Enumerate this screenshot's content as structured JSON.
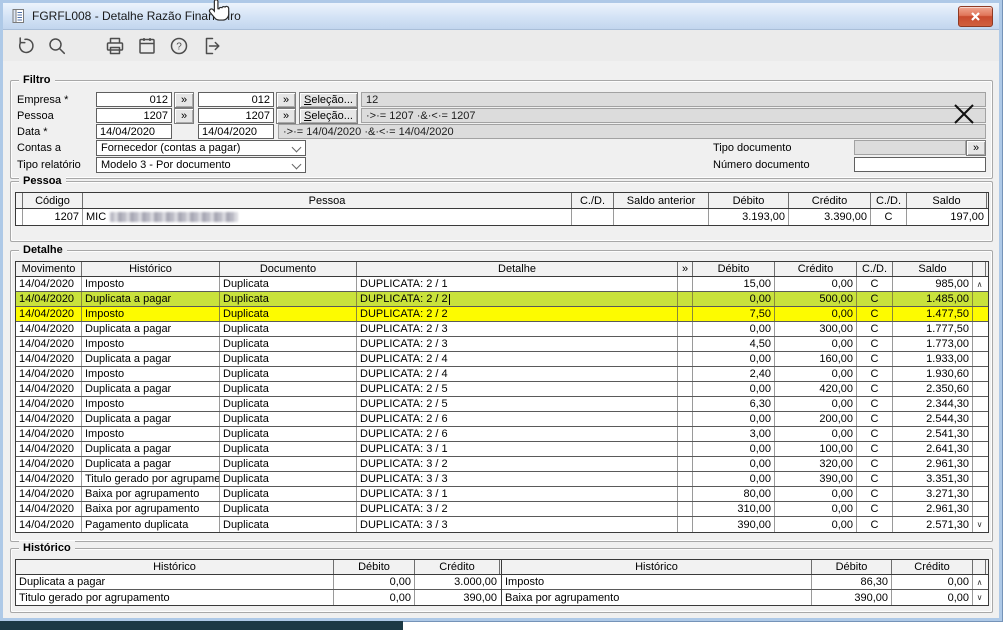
{
  "window": {
    "title": "FGRFL008 - Detalhe Razão Financeiro"
  },
  "toolbar": {
    "icons": [
      "undo",
      "search",
      "print",
      "calendar",
      "help",
      "exit"
    ]
  },
  "filter": {
    "legend": "Filtro",
    "empresa": {
      "label": "Empresa *",
      "from": "012",
      "to": "012",
      "selection": "Seleção...",
      "summary": "12"
    },
    "pessoa": {
      "label": "Pessoa",
      "from": "1207",
      "to": "1207",
      "selection": "Seleção...",
      "summary": "·>·= 1207  ·&·<·= 1207"
    },
    "data": {
      "label": "Data *",
      "from": "14/04/2020",
      "to": "14/04/2020",
      "summary": "·>·= 14/04/2020  ·&·<·= 14/04/2020"
    },
    "contas": {
      "label": "Contas a",
      "value": "Fornecedor (contas a pagar)"
    },
    "tipo_relatorio": {
      "label": "Tipo relatório",
      "value": "Modelo 3 - Por documento"
    },
    "tipo_documento": {
      "label": "Tipo documento",
      "value": ""
    },
    "numero_documento": {
      "label": "Número documento",
      "value": ""
    },
    "more_label": "»"
  },
  "pessoa_section": {
    "legend": "Pessoa",
    "headers": [
      "",
      "Código",
      "Pessoa",
      "C./D.",
      "Saldo anterior",
      "Débito",
      "Crédito",
      "C./D.",
      "Saldo"
    ],
    "row": {
      "codigo": "1207",
      "pessoa_visible": "MIC",
      "cd1": "",
      "saldo_anterior": "",
      "debito": "3.193,00",
      "credito": "3.390,00",
      "cd2": "C",
      "saldo": "197,00"
    }
  },
  "detalhe_section": {
    "legend": "Detalhe",
    "headers": [
      "Movimento",
      "Histórico",
      "Documento",
      "Detalhe",
      "»",
      "Débito",
      "Crédito",
      "C./D.",
      "Saldo",
      ""
    ],
    "rows": [
      {
        "movimento": "14/04/2020",
        "historico": "Imposto",
        "documento": "Duplicata",
        "detalhe": "DUPLICATA: 2 / 1",
        "debito": "15,00",
        "credito": "0,00",
        "cd": "C",
        "saldo": "985,00",
        "highlight": "none"
      },
      {
        "movimento": "14/04/2020",
        "historico": "Duplicata a pagar",
        "documento": "Duplicata",
        "detalhe": "DUPLICATA: 2 / 2",
        "debito": "0,00",
        "credito": "500,00",
        "cd": "C",
        "saldo": "1.485,00",
        "highlight": "green"
      },
      {
        "movimento": "14/04/2020",
        "historico": "Imposto",
        "documento": "Duplicata",
        "detalhe": "DUPLICATA: 2 / 2",
        "debito": "7,50",
        "credito": "0,00",
        "cd": "C",
        "saldo": "1.477,50",
        "highlight": "yellow"
      },
      {
        "movimento": "14/04/2020",
        "historico": "Duplicata a pagar",
        "documento": "Duplicata",
        "detalhe": "DUPLICATA: 2 / 3",
        "debito": "0,00",
        "credito": "300,00",
        "cd": "C",
        "saldo": "1.777,50",
        "highlight": "none"
      },
      {
        "movimento": "14/04/2020",
        "historico": "Imposto",
        "documento": "Duplicata",
        "detalhe": "DUPLICATA: 2 / 3",
        "debito": "4,50",
        "credito": "0,00",
        "cd": "C",
        "saldo": "1.773,00",
        "highlight": "none"
      },
      {
        "movimento": "14/04/2020",
        "historico": "Duplicata a pagar",
        "documento": "Duplicata",
        "detalhe": "DUPLICATA: 2 / 4",
        "debito": "0,00",
        "credito": "160,00",
        "cd": "C",
        "saldo": "1.933,00",
        "highlight": "none"
      },
      {
        "movimento": "14/04/2020",
        "historico": "Imposto",
        "documento": "Duplicata",
        "detalhe": "DUPLICATA: 2 / 4",
        "debito": "2,40",
        "credito": "0,00",
        "cd": "C",
        "saldo": "1.930,60",
        "highlight": "none"
      },
      {
        "movimento": "14/04/2020",
        "historico": "Duplicata a pagar",
        "documento": "Duplicata",
        "detalhe": "DUPLICATA: 2 / 5",
        "debito": "0,00",
        "credito": "420,00",
        "cd": "C",
        "saldo": "2.350,60",
        "highlight": "none"
      },
      {
        "movimento": "14/04/2020",
        "historico": "Imposto",
        "documento": "Duplicata",
        "detalhe": "DUPLICATA: 2 / 5",
        "debito": "6,30",
        "credito": "0,00",
        "cd": "C",
        "saldo": "2.344,30",
        "highlight": "none"
      },
      {
        "movimento": "14/04/2020",
        "historico": "Duplicata a pagar",
        "documento": "Duplicata",
        "detalhe": "DUPLICATA: 2 / 6",
        "debito": "0,00",
        "credito": "200,00",
        "cd": "C",
        "saldo": "2.544,30",
        "highlight": "none"
      },
      {
        "movimento": "14/04/2020",
        "historico": "Imposto",
        "documento": "Duplicata",
        "detalhe": "DUPLICATA: 2 / 6",
        "debito": "3,00",
        "credito": "0,00",
        "cd": "C",
        "saldo": "2.541,30",
        "highlight": "none"
      },
      {
        "movimento": "14/04/2020",
        "historico": "Duplicata a pagar",
        "documento": "Duplicata",
        "detalhe": "DUPLICATA: 3 / 1",
        "debito": "0,00",
        "credito": "100,00",
        "cd": "C",
        "saldo": "2.641,30",
        "highlight": "none"
      },
      {
        "movimento": "14/04/2020",
        "historico": "Duplicata a pagar",
        "documento": "Duplicata",
        "detalhe": "DUPLICATA: 3 / 2",
        "debito": "0,00",
        "credito": "320,00",
        "cd": "C",
        "saldo": "2.961,30",
        "highlight": "none"
      },
      {
        "movimento": "14/04/2020",
        "historico": "Titulo gerado por agrupamento",
        "documento": "Duplicata",
        "detalhe": "DUPLICATA: 3 / 3",
        "debito": "0,00",
        "credito": "390,00",
        "cd": "C",
        "saldo": "3.351,30",
        "highlight": "none"
      },
      {
        "movimento": "14/04/2020",
        "historico": "Baixa por agrupamento",
        "documento": "Duplicata",
        "detalhe": "DUPLICATA: 3 / 1",
        "debito": "80,00",
        "credito": "0,00",
        "cd": "C",
        "saldo": "3.271,30",
        "highlight": "none"
      },
      {
        "movimento": "14/04/2020",
        "historico": "Baixa por agrupamento",
        "documento": "Duplicata",
        "detalhe": "DUPLICATA: 3 / 2",
        "debito": "310,00",
        "credito": "0,00",
        "cd": "C",
        "saldo": "2.961,30",
        "highlight": "none"
      },
      {
        "movimento": "14/04/2020",
        "historico": "Pagamento duplicata",
        "documento": "Duplicata",
        "detalhe": "DUPLICATA: 3 / 3",
        "debito": "390,00",
        "credito": "0,00",
        "cd": "C",
        "saldo": "2.571,30",
        "highlight": "none"
      }
    ]
  },
  "historico_section": {
    "legend": "Histórico",
    "headers": [
      "Histórico",
      "Débito",
      "Crédito"
    ],
    "left_rows": [
      {
        "historico": "Duplicata a pagar",
        "debito": "0,00",
        "credito": "3.000,00"
      },
      {
        "historico": "Titulo gerado por agrupamento",
        "debito": "0,00",
        "credito": "390,00"
      }
    ],
    "right_rows": [
      {
        "historico": "Imposto",
        "debito": "86,30",
        "credito": "0,00"
      },
      {
        "historico": "Baixa por agrupamento",
        "debito": "390,00",
        "credito": "0,00"
      }
    ]
  },
  "colors": {
    "highlight_green": "#c9e23c",
    "highlight_yellow": "#fdfb00",
    "close_button_red": "#cf4a30",
    "titlebar_blue": "#c2d6ee"
  },
  "scroll": {
    "up": "∧",
    "down": "∨"
  }
}
